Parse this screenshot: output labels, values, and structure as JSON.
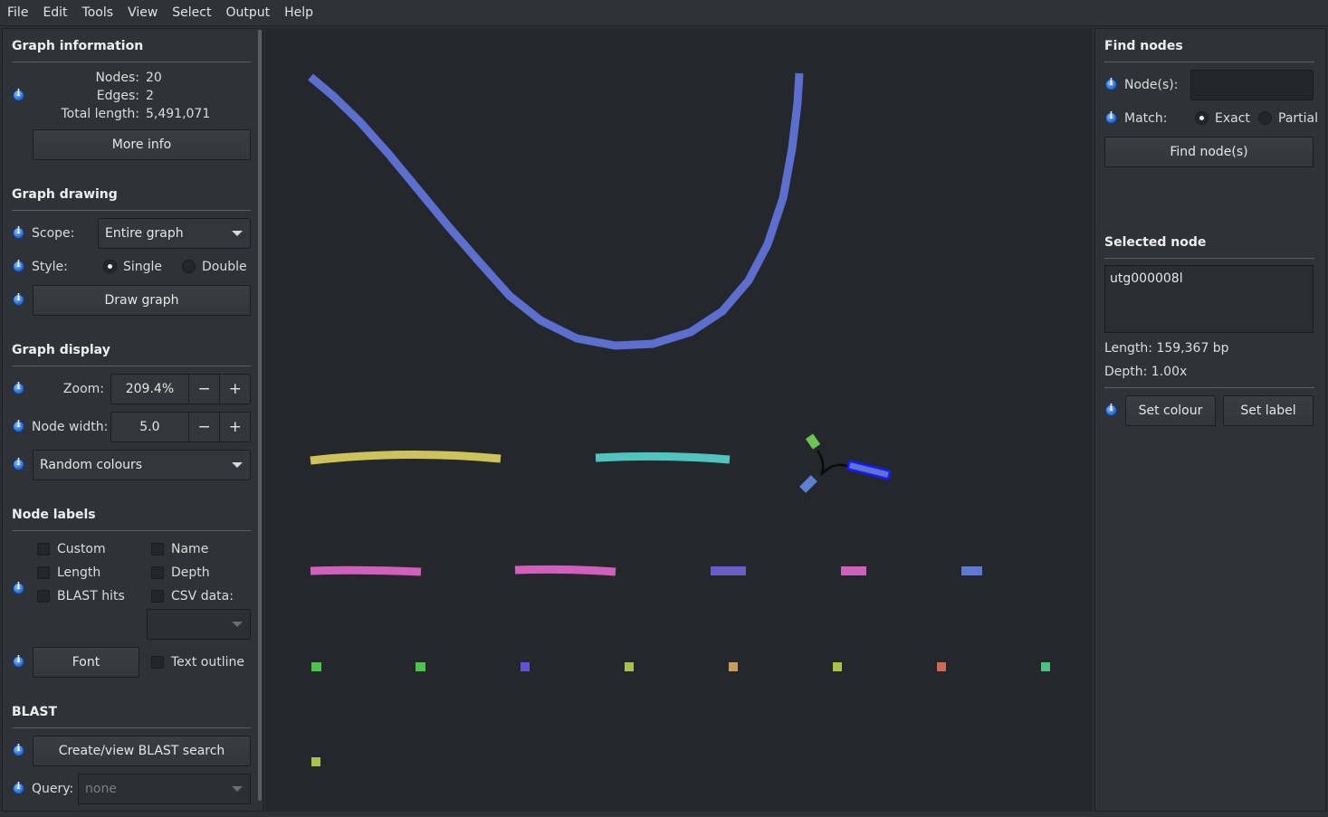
{
  "menu": [
    "File",
    "Edit",
    "Tools",
    "View",
    "Select",
    "Output",
    "Help"
  ],
  "graph_info": {
    "title": "Graph information",
    "nodes_label": "Nodes:",
    "nodes_value": "20",
    "edges_label": "Edges:",
    "edges_value": "2",
    "length_label": "Total length:",
    "length_value": "5,491,071",
    "more_info": "More info"
  },
  "graph_drawing": {
    "title": "Graph drawing",
    "scope_label": "Scope:",
    "scope_value": "Entire graph",
    "style_label": "Style:",
    "style_single": "Single",
    "style_double": "Double",
    "style_selected": "Single",
    "draw_button": "Draw graph"
  },
  "graph_display": {
    "title": "Graph display",
    "zoom_label": "Zoom:",
    "zoom_value": "209.4%",
    "node_width_label": "Node width:",
    "node_width_value": "5.0",
    "minus": "−",
    "plus": "+",
    "colour_scheme": "Random colours"
  },
  "node_labels": {
    "title": "Node labels",
    "custom": "Custom",
    "name": "Name",
    "length": "Length",
    "depth": "Depth",
    "blast_hits": "BLAST hits",
    "csv_data": "CSV data:",
    "font_button": "Font",
    "text_outline": "Text outline"
  },
  "blast": {
    "title": "BLAST",
    "search_button": "Create/view BLAST search",
    "query_label": "Query:",
    "query_value": "none"
  },
  "find_nodes": {
    "title": "Find nodes",
    "nodes_label": "Node(s):",
    "nodes_value": "",
    "match_label": "Match:",
    "exact": "Exact",
    "partial": "Partial",
    "match_selected": "Exact",
    "find_button": "Find node(s)"
  },
  "selected_node": {
    "title": "Selected node",
    "name": "utg000008l",
    "length": "Length: 159,367 bp",
    "depth": "Depth: 1.00x",
    "set_colour": "Set colour",
    "set_label": "Set label"
  },
  "colors": {
    "canvas_bg": "#24272b",
    "panel_bg": "#2f3338",
    "selected_outline": "#1a1aff",
    "edge": "#000000"
  }
}
